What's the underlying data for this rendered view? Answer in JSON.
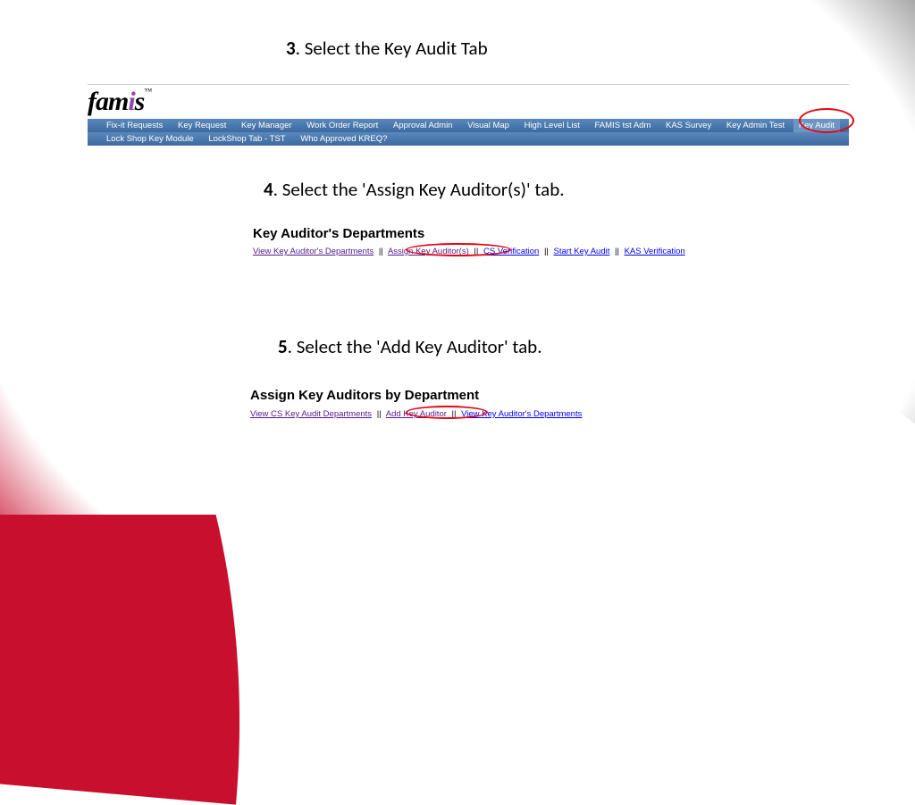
{
  "step3": {
    "num": "3",
    "text": ". Select the Key Audit Tab"
  },
  "step4": {
    "num": "4",
    "text": ". Select the 'Assign Key Auditor(s)' tab."
  },
  "step5": {
    "num": "5",
    "text": ". Select the 'Add Key Auditor' tab."
  },
  "logo": {
    "prefix": "fam",
    "i": "i",
    "suffix": "s",
    "tm": "™"
  },
  "nav": {
    "row1": [
      "Fix-it Requests",
      "Key Request",
      "Key Manager",
      "Work Order Report",
      "Approval Admin",
      "Visual Map",
      "High Level List",
      "FAMIS tst Adm",
      "KAS Survey",
      "Key Admin Test",
      "Key Audit"
    ],
    "row2": [
      "Lock Shop Key Module",
      "LockShop Tab - TST",
      "Who Approved KREQ?"
    ]
  },
  "section1": {
    "heading": "Key Auditor's Departments",
    "links": [
      {
        "label": "View Key Auditor's Departments",
        "cls": ""
      },
      {
        "label": "Assign Key Auditor(s)",
        "cls": ""
      },
      {
        "label": "CS Verification",
        "cls": "blue"
      },
      {
        "label": "Start Key Audit",
        "cls": "blue"
      },
      {
        "label": "KAS Verification",
        "cls": "blue"
      }
    ]
  },
  "section2": {
    "heading": "Assign Key Auditors by Department",
    "links": [
      {
        "label": "View CS Key Audit Departments",
        "cls": ""
      },
      {
        "label": "Add Key Auditor",
        "cls": ""
      },
      {
        "label": "View Key Auditor's Departments",
        "cls": "blue"
      }
    ]
  },
  "sep": "||"
}
